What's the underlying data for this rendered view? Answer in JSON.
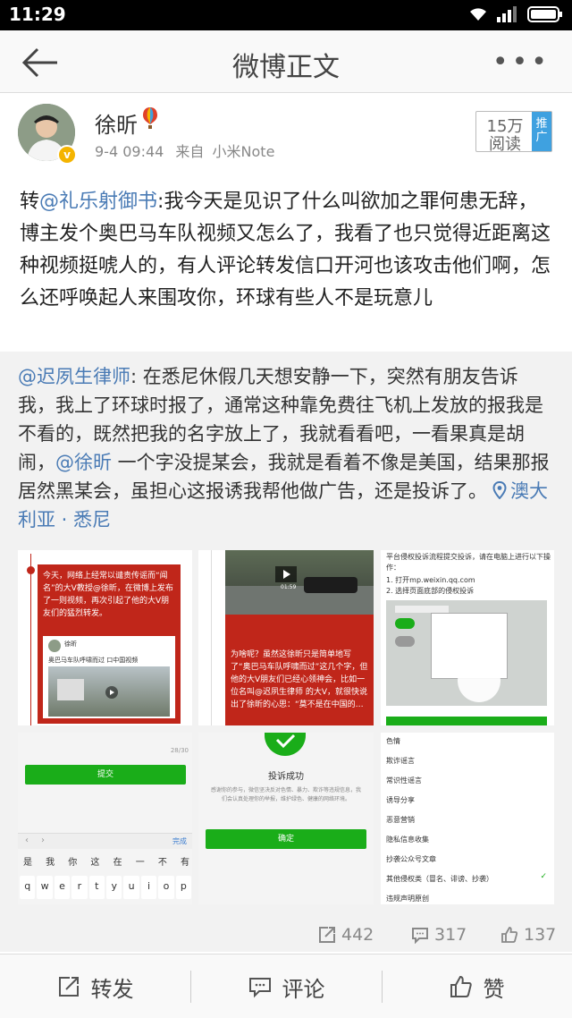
{
  "status": {
    "time": "11:29"
  },
  "nav": {
    "title": "微博正文",
    "more": "•••"
  },
  "post": {
    "user_name": "徐昕",
    "date": "9-4 09:44",
    "source_prefix": "来自",
    "source": "小米Note",
    "read_count": "15万",
    "read_label": "阅读",
    "promo_tag": "推广",
    "text_prefix": "转",
    "mention": "@礼乐射御书",
    "text_body": ":我今天是见识了什么叫欲加之罪何患无辞，博主发个奥巴马车队视频又怎么了，我看了也只觉得近距离这种视频挺唬人的，有人评论转发信口开河也该攻击他们啊，怎么还呼唤起人来围攻你，环球有些人不是玩意儿"
  },
  "quoted": {
    "mention": "@迟夙生律师",
    "text_a": ": 在悉尼休假几天想安静一下，突然有朋友告诉我，我上了环球时报了，通常这种靠免费往飞机上发放的报我是不看的，既然把我的名字放上了，我就看看吧，一看果真是胡闹，",
    "mention2": "@徐昕",
    "text_b": "  一个字没提某会，我就是看着不像是美国，结果那报居然黑某会，虽担心这报诱我帮他做广告，还是投诉了。",
    "location": "澳大利亚 · 悉尼"
  },
  "stats": {
    "reposts": "442",
    "comments": "317",
    "likes": "137"
  },
  "actions": {
    "repost": "转发",
    "comment": "评论",
    "like": "赞"
  },
  "thumbs": {
    "t1": {
      "banner": "今天，网络上经常以谴责传谣而“闻名”的大V教授@徐昕，在微博上发布了一则视频，再次引起了他的大V朋友们的猛烈转发。",
      "card_user": "徐昕",
      "card_text": "奥巴马车队呼啸而过 口中国视频",
      "counter": "28/30",
      "submit": "提交",
      "done": "完成",
      "ime_candidates": [
        "是",
        "我",
        "你",
        "这",
        "在",
        "一",
        "不",
        "有"
      ],
      "keys": [
        "q",
        "w",
        "e",
        "r",
        "t",
        "y",
        "u",
        "i",
        "o",
        "p"
      ]
    },
    "t2": {
      "video_time": "01:59",
      "text": "为啥呢？虽然这徐昕只是简单地写了“奥巴马车队呼啸而过”这几个字，但他的大V朋友们已经心领神会，比如一位名叫@迟夙生律师 的大V，就很快说出了徐昕的心思：“莫不是在中国的…",
      "success": "投诉成功",
      "success_desc": "感谢你的参与，微信坚决反对色情、暴力、欺诈等违规信息，我们会认真处理你的举报，维护绿色、健康的网络环境。",
      "ok": "确定"
    },
    "t3": {
      "instruction": "平台侵权投诉流程提交投诉，请在电脑上进行以下操作：",
      "step1": "1. 打开mp.weixin.qq.com",
      "step2": "2. 选择页面底部的侵权投诉",
      "options": [
        "色情",
        "欺诈谣言",
        "常识性谣言",
        "诱导分享",
        "恶意营销",
        "隐私信息收集",
        "抄袭公众号文章",
        "其他侵权类（冒名、诽谤、抄袭）",
        "违规声明原创"
      ]
    }
  },
  "colors": {
    "link": "#4a7bb5",
    "wechat_green": "#1aad19",
    "report_red": "#c0261a"
  }
}
